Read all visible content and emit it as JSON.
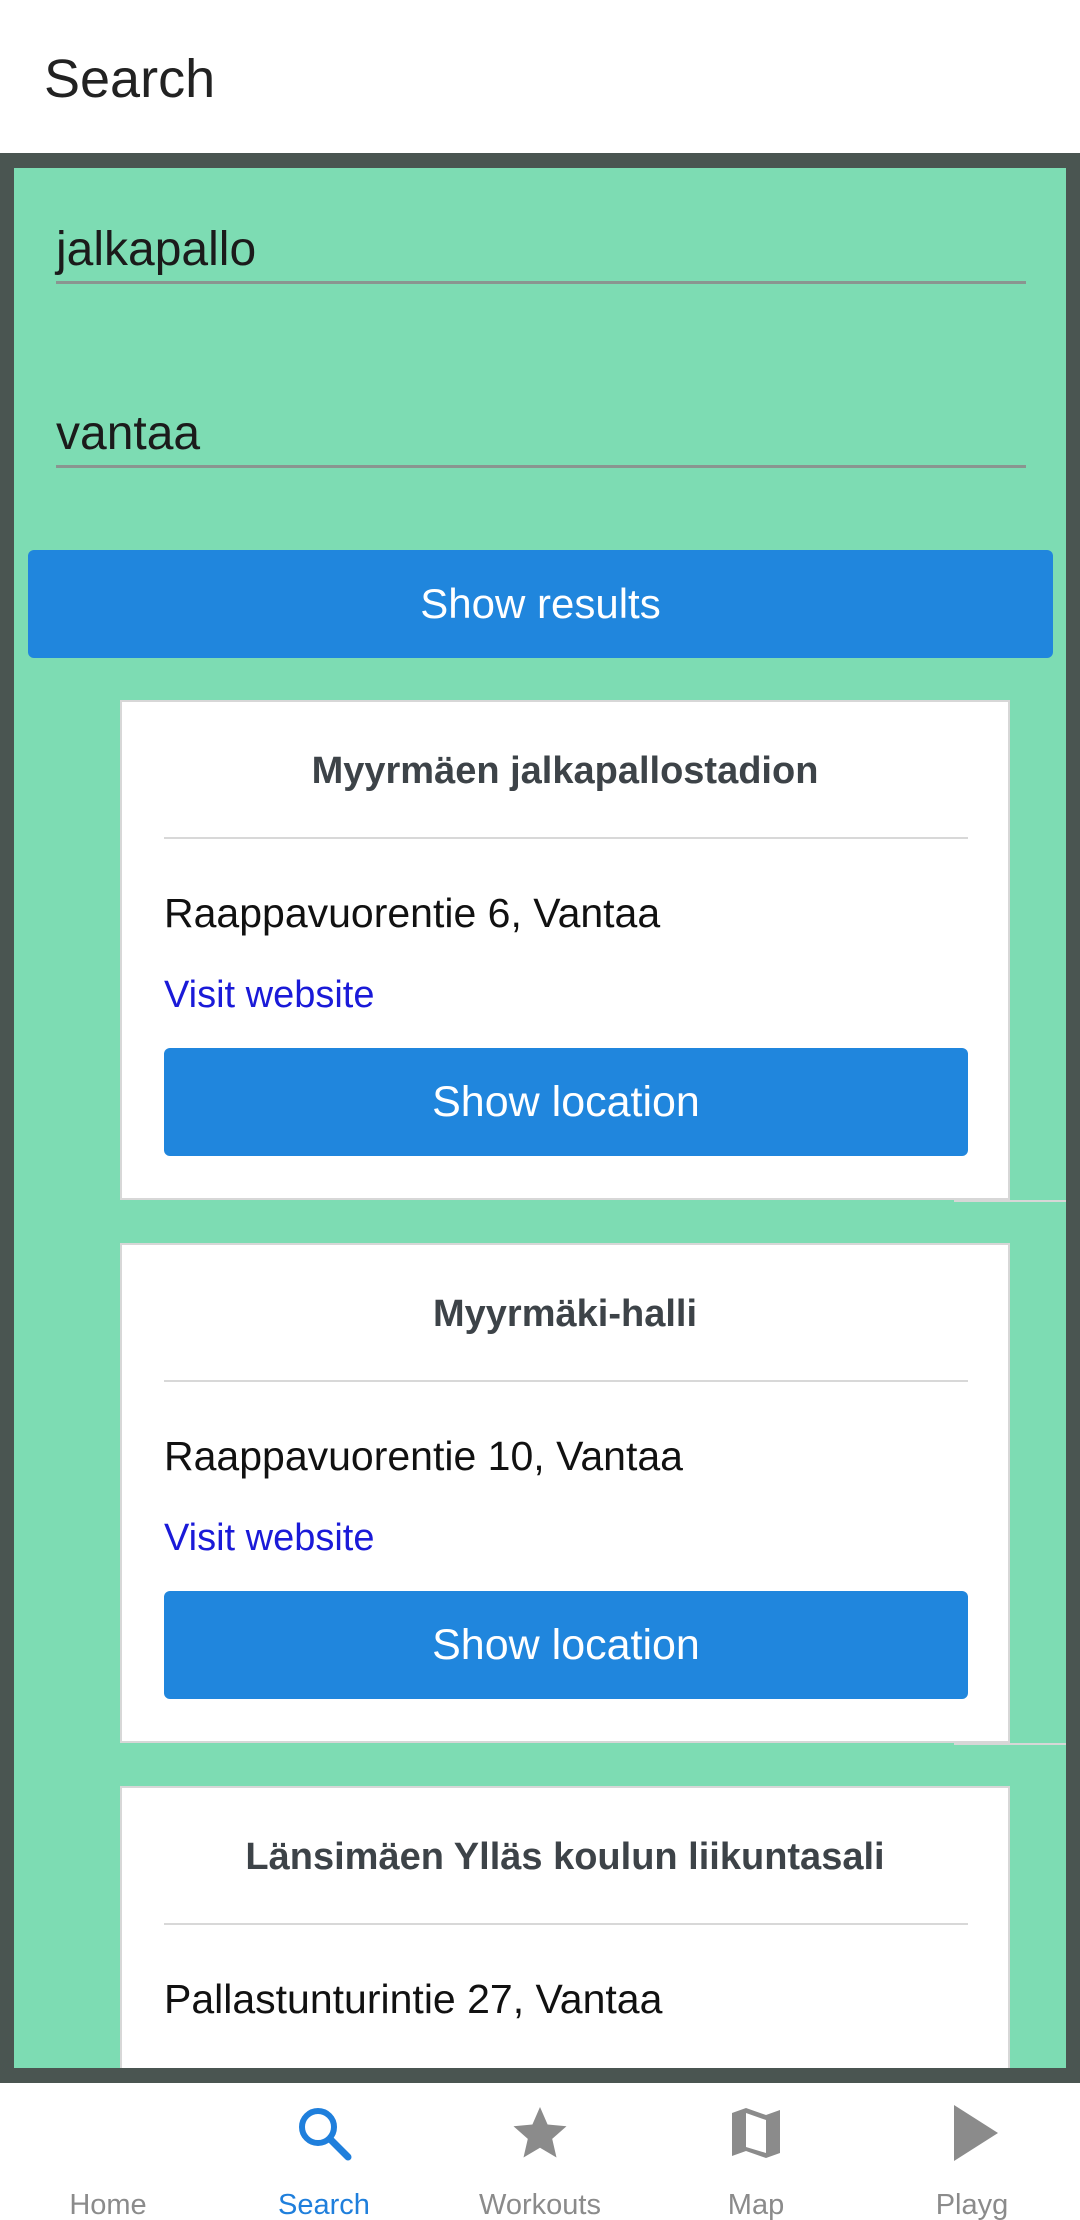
{
  "header": {
    "title": "Search"
  },
  "search": {
    "activity_value": "jalkapallo",
    "city_value": "vantaa",
    "submit_label": "Show results"
  },
  "results": [
    {
      "name": "Myyrmäen jalkapallostadion",
      "address": "Raappavuorentie 6, Vantaa",
      "link_label": "Visit website",
      "button_label": "Show location"
    },
    {
      "name": "Myyrmäki-halli",
      "address": "Raappavuorentie 10, Vantaa",
      "link_label": "Visit website",
      "button_label": "Show location"
    },
    {
      "name": "Länsimäen Ylläs koulun liikuntasali",
      "address": "Pallastunturintie 27, Vantaa"
    }
  ],
  "bottom_nav": {
    "items": [
      {
        "label": "Home",
        "icon": "home-icon"
      },
      {
        "label": "Search",
        "icon": "search-icon",
        "active": true
      },
      {
        "label": "Workouts",
        "icon": "star-icon"
      },
      {
        "label": "Map",
        "icon": "map-icon"
      },
      {
        "label": "Playg",
        "icon": "play-icon"
      }
    ]
  },
  "colors": {
    "accent": "#2086dd",
    "panel_green": "#7ddcb3",
    "frame_dark": "#4a5551",
    "link": "#1a1ad8",
    "nav_active": "#1f7fdc",
    "nav_inactive": "#8b8b8b"
  }
}
